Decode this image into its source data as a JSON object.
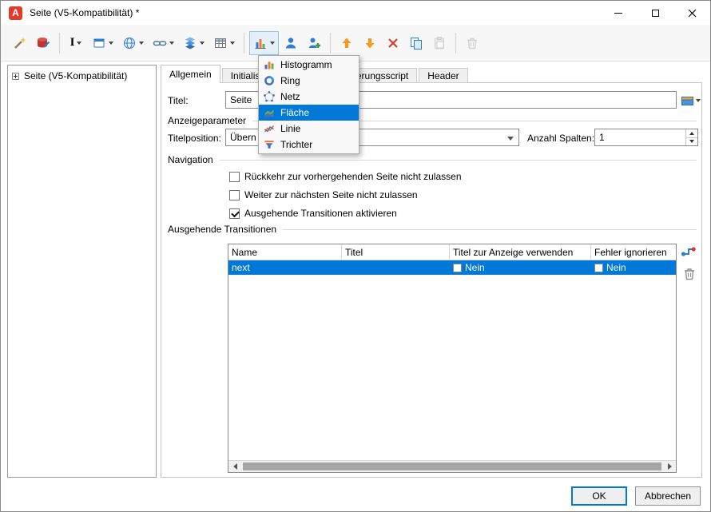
{
  "window": {
    "title": "Seite (V5-Kompatibilität) *",
    "app_letter": "A"
  },
  "toolbar": {
    "field_glyph": "I"
  },
  "tree": {
    "root_label": "Seite (V5-Kompatibilität)"
  },
  "tabs": [
    {
      "label": "Allgemein",
      "selected": true
    },
    {
      "label": "Initialisierungsscript",
      "selected": false
    },
    {
      "label": "Validierungsscript",
      "selected": false
    },
    {
      "label": "Header",
      "selected": false
    }
  ],
  "form": {
    "titel_label": "Titel:",
    "titel_value": "Seite",
    "group_anzeigeparameter": "Anzeigeparameter",
    "titelposition_label": "Titelposition:",
    "titelposition_value": "Übern",
    "anzahl_spalten_label": "Anzahl Spalten:",
    "anzahl_spalten_value": "1",
    "group_navigation": "Navigation",
    "checkboxes": [
      {
        "label": "Rückkehr zur vorhergehenden Seite nicht zulassen",
        "checked": false
      },
      {
        "label": "Weiter zur nächsten Seite nicht zulassen",
        "checked": false
      },
      {
        "label": "Ausgehende Transitionen aktivieren",
        "checked": true
      }
    ],
    "group_transitionen": "Ausgehende Transitionen"
  },
  "transitions_table": {
    "headers": [
      "Name",
      "Titel",
      "Titel zur Anzeige verwenden",
      "Fehler ignorieren"
    ],
    "rows": [
      {
        "name": "next",
        "titel": "",
        "titel_anzeige_verwenden": "Nein",
        "fehler_ignorieren": "Nein",
        "selected": true
      }
    ]
  },
  "chart_menu": {
    "items": [
      {
        "label": "Histogramm",
        "selected": false
      },
      {
        "label": "Ring",
        "selected": false
      },
      {
        "label": "Netz",
        "selected": false
      },
      {
        "label": "Fläche",
        "selected": true
      },
      {
        "label": "Linie",
        "selected": false
      },
      {
        "label": "Trichter",
        "selected": false
      }
    ]
  },
  "footer": {
    "ok_label": "OK",
    "cancel_label": "Abbrechen"
  },
  "colors": {
    "selection_blue": "#0078d7",
    "app_icon_red": "#e23b2e"
  }
}
